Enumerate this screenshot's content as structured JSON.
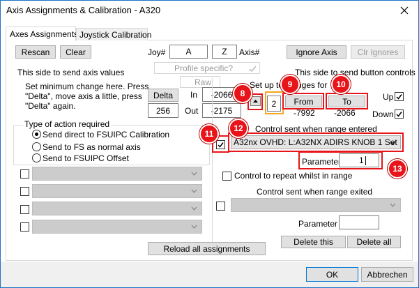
{
  "window": {
    "title": "Axis Assignments & Calibration - A320"
  },
  "tabs": [
    {
      "label": "Axes Assignments"
    },
    {
      "label": "Joystick Calibration"
    }
  ],
  "top": {
    "rescan": "Rescan",
    "clear": "Clear",
    "joy_label": "Joy#",
    "joy_value": "A",
    "axis_value": "Z",
    "axis_label": "Axis#",
    "ignore_axis": "Ignore Axis",
    "clr_ignores": "Clr Ignores",
    "profile_specific": "Profile specific?"
  },
  "left": {
    "heading": "This side to send axis values",
    "instructions": [
      "Set minimum change  here.  Press",
      "\"Delta\", move axis a little,  press",
      "\"Delta\" again."
    ],
    "delta_button": "Delta",
    "delta_value": "256",
    "raw_label": "Raw",
    "in_label": "In",
    "in_value": "-2066",
    "out_label": "Out",
    "out_value": "-2175",
    "action_group": "Type of action required",
    "options": [
      "Send direct to FSUIPC Calibration",
      "Send to FS as normal axis",
      "Send to FSUIPC Offset"
    ],
    "selected_option": 0
  },
  "right": {
    "heading": "This side to send button controls",
    "ranges_label": "Set up to 10 ranges for",
    "ranges_visible_left": "Set up to",
    "ranges_visible_right": "nges for",
    "range_number": "2",
    "from_button": "From",
    "to_button": "To",
    "from_value": "-7992",
    "to_value": "-2066",
    "up_label": "Up",
    "down_label": "Down",
    "entered_label": "Control sent when range entered",
    "entered_control": "A32nx OVHD: L:A32NX ADIRS KNOB 1 Set",
    "parameter_label": "Parameter",
    "parameter_value": "1",
    "repeat_label": "Control to repeat whilst in range",
    "exited_label": "Control sent when range exited",
    "parameter2_label": "Parameter",
    "delete_this": "Delete this",
    "delete_all": "Delete all"
  },
  "reload": "Reload all assignments",
  "footer": {
    "ok": "OK",
    "cancel": "Abbrechen"
  },
  "annotations": [
    "8",
    "9",
    "10",
    "11",
    "12",
    "13"
  ],
  "colors": {
    "accent_red": "#e8141a",
    "accent_orange": "#f5a623",
    "window_border": "#1a73c7"
  }
}
